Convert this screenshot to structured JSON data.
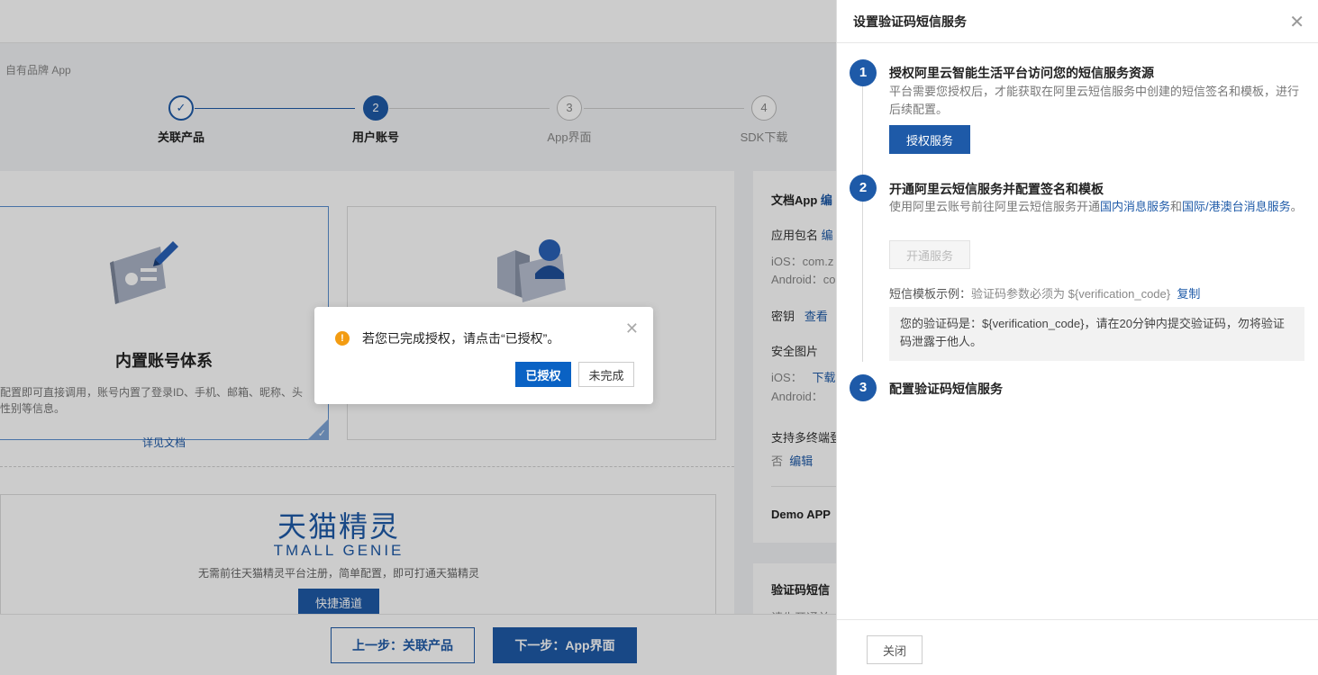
{
  "background": {
    "breadcrumb": "自有品牌 App",
    "steps": [
      {
        "label": "关联产品",
        "state": "done",
        "number": "✓"
      },
      {
        "label": "用户账号",
        "state": "active",
        "number": "2"
      },
      {
        "label": "App界面",
        "state": "todo",
        "number": "3"
      },
      {
        "label": "SDK下载",
        "state": "todo",
        "number": "4"
      }
    ],
    "account_card": {
      "title": "内置账号体系",
      "desc_line1": "配置即可直接调用，账号内置了登录ID、手机、邮箱、昵称、头",
      "desc_line2": "性别等信息。",
      "link": "详见文档"
    },
    "genie": {
      "logo_cn": "天猫精灵",
      "logo_en": "TMALL GENIE",
      "desc": "无需前往天猫精灵平台注册，简单配置，即可打通天猫精灵",
      "button": "快捷通道"
    },
    "side": {
      "title": "文档App",
      "title_edit": "编",
      "pkg_label": "应用包名",
      "pkg_edit": "编",
      "ios_pkg": "iOS：com.z",
      "android_pkg": "Android：co",
      "secret_label": "密钥",
      "secret_link": "查看",
      "image_label": "安全图片",
      "ios_img": "iOS：",
      "ios_img_link": "下载",
      "android_img": "Android：",
      "multi_label": "支持多终端登",
      "multi_value": "否",
      "multi_edit": "编辑",
      "demo_label": "Demo APP",
      "sms_label": "验证码短信",
      "sms_sub": "请先开通并"
    },
    "footer": {
      "prev": "上一步：关联产品",
      "next": "下一步：App界面"
    }
  },
  "dialog": {
    "message": "若您已完成授权，请点击“已授权”。",
    "ok": "已授权",
    "cancel": "未完成",
    "warn_glyph": "!"
  },
  "drawer": {
    "title": "设置验证码短信服务",
    "step1": {
      "num": "1",
      "title": "授权阿里云智能生活平台访问您的短信服务资源",
      "text": "平台需要您授权后，才能获取在阿里云短信服务中创建的短信签名和模板，进行后续配置。",
      "button": "授权服务"
    },
    "step2": {
      "num": "2",
      "title": "开通阿里云短信服务并配置签名和模板",
      "text_pre": "使用阿里云账号前往阿里云短信服务开通",
      "link1": "国内消息服务",
      "text_mid": "和",
      "link2": "国际/港澳台消息服务",
      "text_post": "。",
      "button": "开通服务",
      "tpl_label": "短信模板示例：",
      "tpl_hint": "验证码参数必须为 ${verification_code}",
      "tpl_copy": "复制",
      "tpl_content": "您的验证码是：${verification_code}，请在20分钟内提交验证码，勿将验证码泄露于他人。"
    },
    "step3": {
      "num": "3",
      "title": "配置验证码短信服务"
    },
    "footer_close": "关闭"
  },
  "colors": {
    "primary": "#1e5aa8",
    "dialog_primary": "#0a62c4",
    "warning": "#f39c12"
  }
}
